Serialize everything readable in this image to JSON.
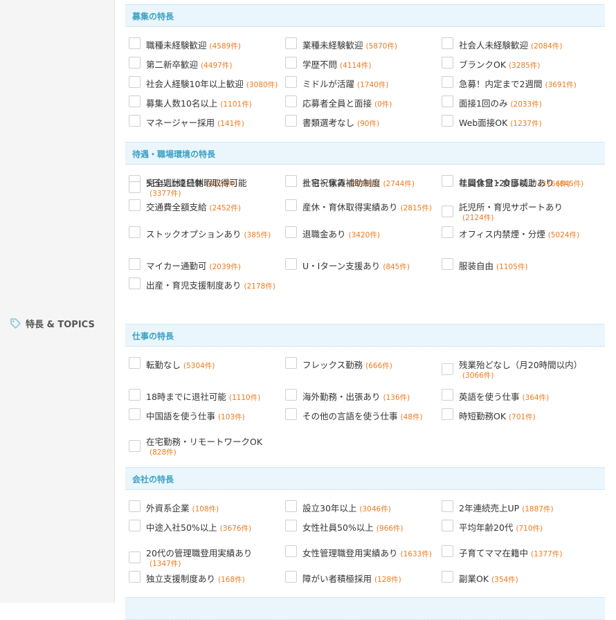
{
  "sidebar": {
    "label": "特長 & TOPICS",
    "icon": "tag-icon"
  },
  "sections": [
    {
      "title": "募集の特長",
      "items": [
        {
          "label": "職種未経験歓迎",
          "count": "(4589件)"
        },
        {
          "label": "業種未経験歓迎",
          "count": "(5870件)"
        },
        {
          "label": "社会人未経験歓迎",
          "count": "(2084件)"
        },
        {
          "label": "第二新卒歓迎",
          "count": "(4497件)"
        },
        {
          "label": "学歴不問",
          "count": "(4114件)"
        },
        {
          "label": "ブランクOK",
          "count": "(3285件)"
        },
        {
          "label": "社会人経験10年以上歓迎",
          "count": "(3080件)"
        },
        {
          "label": "ミドルが活躍",
          "count": "(1740件)"
        },
        {
          "label": "急募！内定まで2週間",
          "count": "(3691件)"
        },
        {
          "label": "募集人数10名以上",
          "count": "(1101件)"
        },
        {
          "label": "応募者全員と面接",
          "count": "(0件)"
        },
        {
          "label": "面接1回のみ",
          "count": "(2033件)"
        },
        {
          "label": "マネージャー採用",
          "count": "(141件)"
        },
        {
          "label": "書類選考なし",
          "count": "(90件)"
        },
        {
          "label": "Web面接OK",
          "count": "(1237件)"
        }
      ]
    },
    {
      "title": "待遇・職場環境の特長",
      "items": [
        {
          "label": "完全週休2日制",
          "count": "(4129件)"
        },
        {
          "label": "土日祝休み",
          "count": "(2986件)"
        },
        {
          "label": "年間休日120日以上",
          "count": "(3766件)"
        },
        {
          "label": "5日以上連続休暇取得可能",
          "count": "(3377件)"
        },
        {
          "label": "社宅・家賃補助制度",
          "count": "(2744件)"
        },
        {
          "label": "社員食堂・食事補助あり",
          "count": "(845件)"
        },
        {
          "label": "交通費全額支給",
          "count": "(2452件)"
        },
        {
          "label": "産休・育休取得実績あり",
          "count": "(2815件)"
        },
        {
          "label": "託児所・育児サポートあり",
          "count": "(2124件)"
        },
        {
          "label": "ストックオプションあり",
          "count": "(385件)"
        },
        {
          "label": "退職金あり",
          "count": "(3420件)"
        },
        {
          "label": "オフィス内禁煙・分煙",
          "count": "(5024件)"
        },
        {
          "label": "マイカー通勤可",
          "count": "(2039件)"
        },
        {
          "label": "U・Iターン支援あり",
          "count": "(845件)"
        },
        {
          "label": "服装自由",
          "count": "(1105件)"
        },
        {
          "label": "出産・育児支援制度あり",
          "count": "(2178件)"
        }
      ]
    },
    {
      "title": "仕事の特長",
      "items": [
        {
          "label": "転勤なし",
          "count": "(5304件)"
        },
        {
          "label": "フレックス勤務",
          "count": "(666件)"
        },
        {
          "label": "残業殆どなし（月20時間以内）",
          "count": "(3066件)"
        },
        {
          "label": "18時までに退社可能",
          "count": "(1110件)"
        },
        {
          "label": "海外勤務・出張あり",
          "count": "(136件)"
        },
        {
          "label": "英語を使う仕事",
          "count": "(364件)"
        },
        {
          "label": "中国語を使う仕事",
          "count": "(103件)"
        },
        {
          "label": "その他の言語を使う仕事",
          "count": "(48件)"
        },
        {
          "label": "時短勤務OK",
          "count": "(701件)"
        },
        {
          "label": "在宅勤務・リモートワークOK",
          "count": "(828件)"
        }
      ]
    },
    {
      "title": "会社の特長",
      "items": [
        {
          "label": "外資系企業",
          "count": "(108件)"
        },
        {
          "label": "設立30年以上",
          "count": "(3046件)"
        },
        {
          "label": "2年連続売上UP",
          "count": "(1887件)"
        },
        {
          "label": "中途入社50%以上",
          "count": "(3676件)"
        },
        {
          "label": "女性社員50%以上",
          "count": "(966件)"
        },
        {
          "label": "平均年齢20代",
          "count": "(710件)"
        },
        {
          "label": "20代の管理職登用実績あり",
          "count": "(1347件)"
        },
        {
          "label": "女性管理職登用実績あり",
          "count": "(1633件)"
        },
        {
          "label": "子育てママ在籍中",
          "count": "(1377件)"
        },
        {
          "label": "独立支援制度あり",
          "count": "(168件)"
        },
        {
          "label": "障がい者積極採用",
          "count": "(128件)"
        },
        {
          "label": "副業OK",
          "count": "(354件)"
        }
      ]
    }
  ]
}
